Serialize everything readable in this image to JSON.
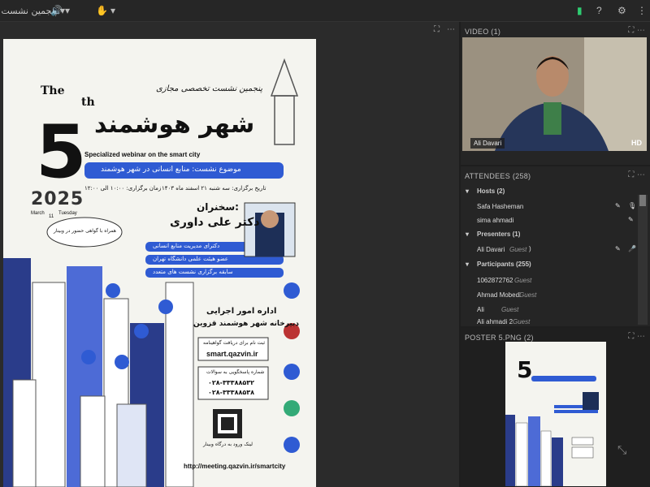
{
  "topbar": {
    "meeting_name": "پنجمین نشست"
  },
  "stage": {
    "poster": {
      "series_label": "The",
      "number": "5",
      "number_suffix": "th",
      "subtitle_fa": "پنجمین نشست تخصصی مجازی",
      "title_fa": "شهر هوشمند",
      "subtitle_en": "Specialized webinar on the smart city",
      "topic_fa": "موضوع نشست: منابع انسانی در شهر هوشمند",
      "date_fa": "تاریخ برگزاری: سه شنبه ۲۱ اسفند ماه ۱۴۰۳",
      "time_fa": "زمان برگزاری: ۱۰:۰۰ الی ۱۲:۰۰",
      "year": "2025",
      "date_en_month": "March",
      "date_en_day": "11",
      "date_en_weekday": "Tuesday",
      "speaker_heading": "سخنران:",
      "speaker_name": "دکتر علی داوری",
      "speaker_bullets": [
        "دکترای مدیریت منابع انسانی",
        "عضو هیئت علمی دانشگاه تهران",
        "سابقه برگزاری نشست های متعدد"
      ],
      "cloud_note": "همراه با گواهی حضور در وبینار",
      "org_line1": "اداره امور اجرایی",
      "org_line2": "دبیرخانه شهر هوشمند قزوین",
      "reg_label": "ثبت نام برای دریافت گواهینامه",
      "reg_url": "smart.qazvin.ir",
      "phone_label": "شماره پاسخگویی به سوالات",
      "phone1": "۰۲۸-۳۳۳۸۸۵۳۲",
      "phone2": "۰۲۸-۳۳۳۸۸۵۳۸",
      "qr_caption": "لینک ورود به درگاه وبینار",
      "meeting_url": "http://meeting.qazvin.ir/smartcity"
    }
  },
  "video_panel": {
    "title": "VIDEO (1)",
    "name_tag": "Ali Davari",
    "hd_badge": "HD"
  },
  "attendees_panel": {
    "title": "ATTENDEES (258)",
    "groups": [
      {
        "label": "Hosts (2)",
        "members": [
          {
            "name": "Safa Hasheman",
            "role": ""
          },
          {
            "name": "sima ahmadi",
            "role": ""
          }
        ]
      },
      {
        "label": "Presenters (1)",
        "members": [
          {
            "name": "Ali Davari",
            "role": "Guest"
          }
        ]
      },
      {
        "label": "Participants (255)",
        "members": [
          {
            "name": "1062872762",
            "role": "Guest"
          },
          {
            "name": "Ahmad Mobedi",
            "role": "Guest"
          },
          {
            "name": "Ali",
            "role": "Guest"
          },
          {
            "name": "Ali ahmadi 2",
            "role": "Guest"
          }
        ]
      }
    ]
  },
  "poster_panel": {
    "title": "POSTER 5.PNG (2)"
  },
  "colors": {
    "accent_blue": "#2f5bd3",
    "dark_bg": "#1e1e1e",
    "panel_bg": "#252525",
    "green": "#2ecc71"
  }
}
